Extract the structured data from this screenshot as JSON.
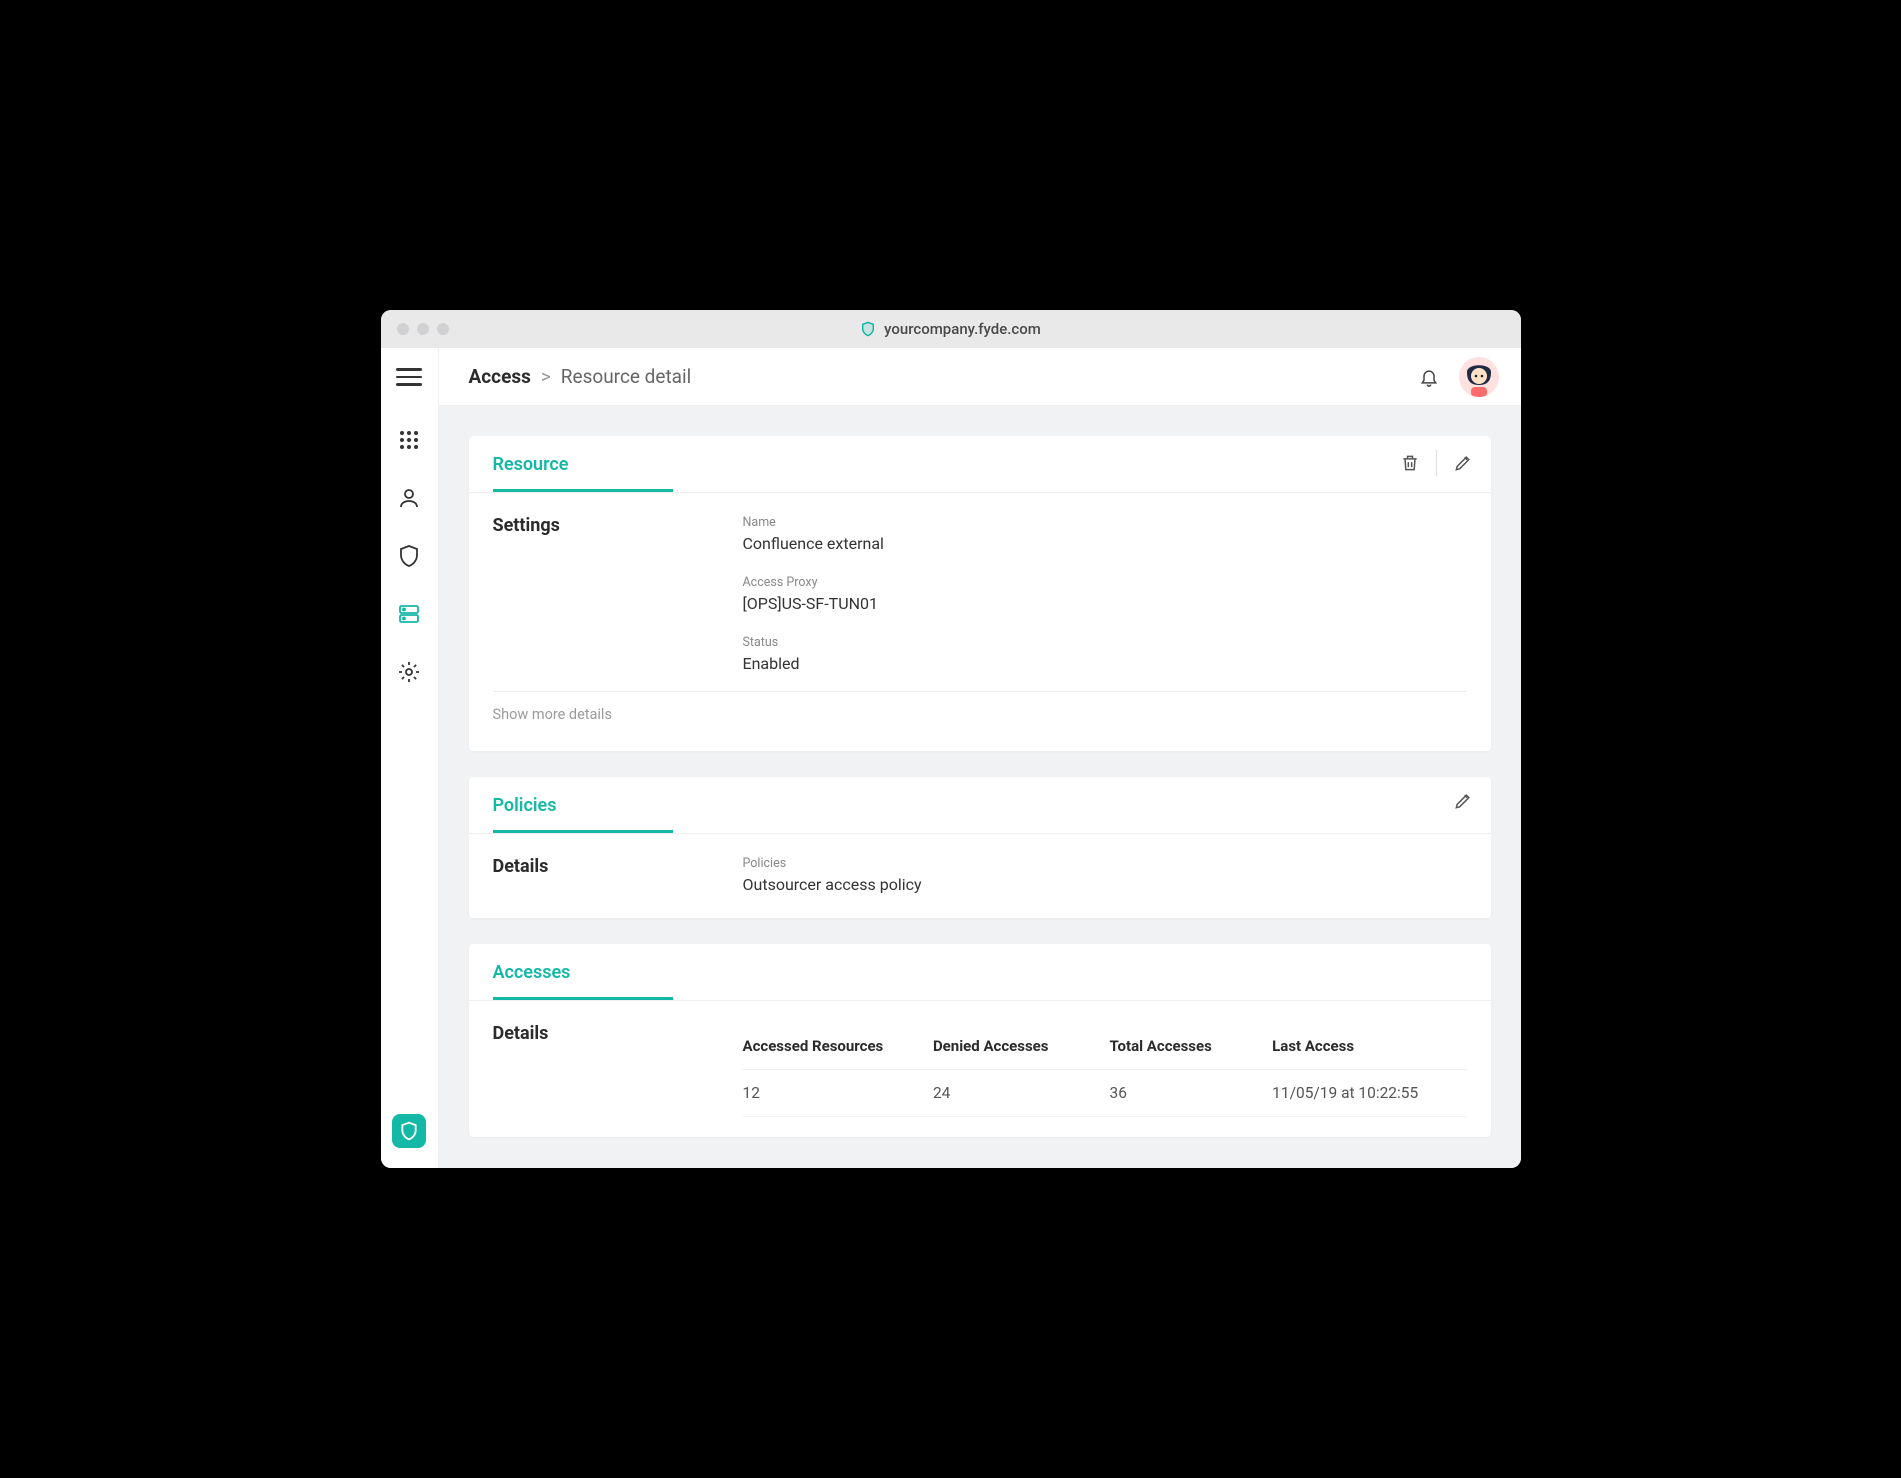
{
  "window": {
    "url": "yourcompany.fyde.com"
  },
  "breadcrumb": {
    "root": "Access",
    "leaf": "Resource detail",
    "sep": ">"
  },
  "sidebar": {
    "items": [
      {
        "name": "apps",
        "label": "Apps"
      },
      {
        "name": "user",
        "label": "User"
      },
      {
        "name": "shield",
        "label": "Shield"
      },
      {
        "name": "server",
        "label": "Server"
      },
      {
        "name": "settings",
        "label": "Settings"
      }
    ]
  },
  "resource": {
    "card_title": "Resource",
    "section_label": "Settings",
    "fields": {
      "name_label": "Name",
      "name_value": "Confluence external",
      "proxy_label": "Access Proxy",
      "proxy_value": "[OPS]US-SF-TUN01",
      "status_label": "Status",
      "status_value": "Enabled"
    },
    "more_link": "Show more details"
  },
  "policies": {
    "card_title": "Policies",
    "section_label": "Details",
    "field_label": "Policies",
    "field_value": "Outsourcer access policy"
  },
  "accesses": {
    "card_title": "Accesses",
    "section_label": "Details",
    "columns": {
      "c0": "Accessed Resources",
      "c1": "Denied Accesses",
      "c2": "Total Accesses",
      "c3": "Last Access"
    },
    "row": {
      "c0": "12",
      "c1": "24",
      "c2": "36",
      "c3": "11/05/19 at 10:22:55"
    }
  }
}
